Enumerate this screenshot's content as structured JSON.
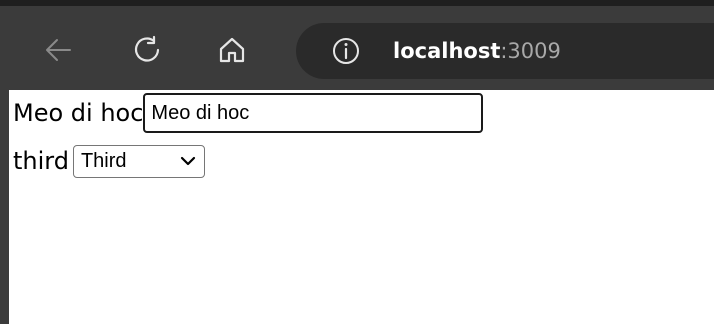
{
  "browser": {
    "url_host": "localhost",
    "url_port": ":3009",
    "icons": {
      "back": "back-arrow-icon",
      "refresh": "refresh-icon",
      "home": "home-icon",
      "info": "info-icon"
    }
  },
  "form": {
    "name_label": "Meo di hoc",
    "name_value": "Meo di hoc",
    "choice_label": "third",
    "choice_selected": "Third"
  },
  "colors": {
    "toolbar_bg": "#3b3b3b",
    "address_bar_bg": "#2a2a2a",
    "page_bg": "#ffffff"
  }
}
